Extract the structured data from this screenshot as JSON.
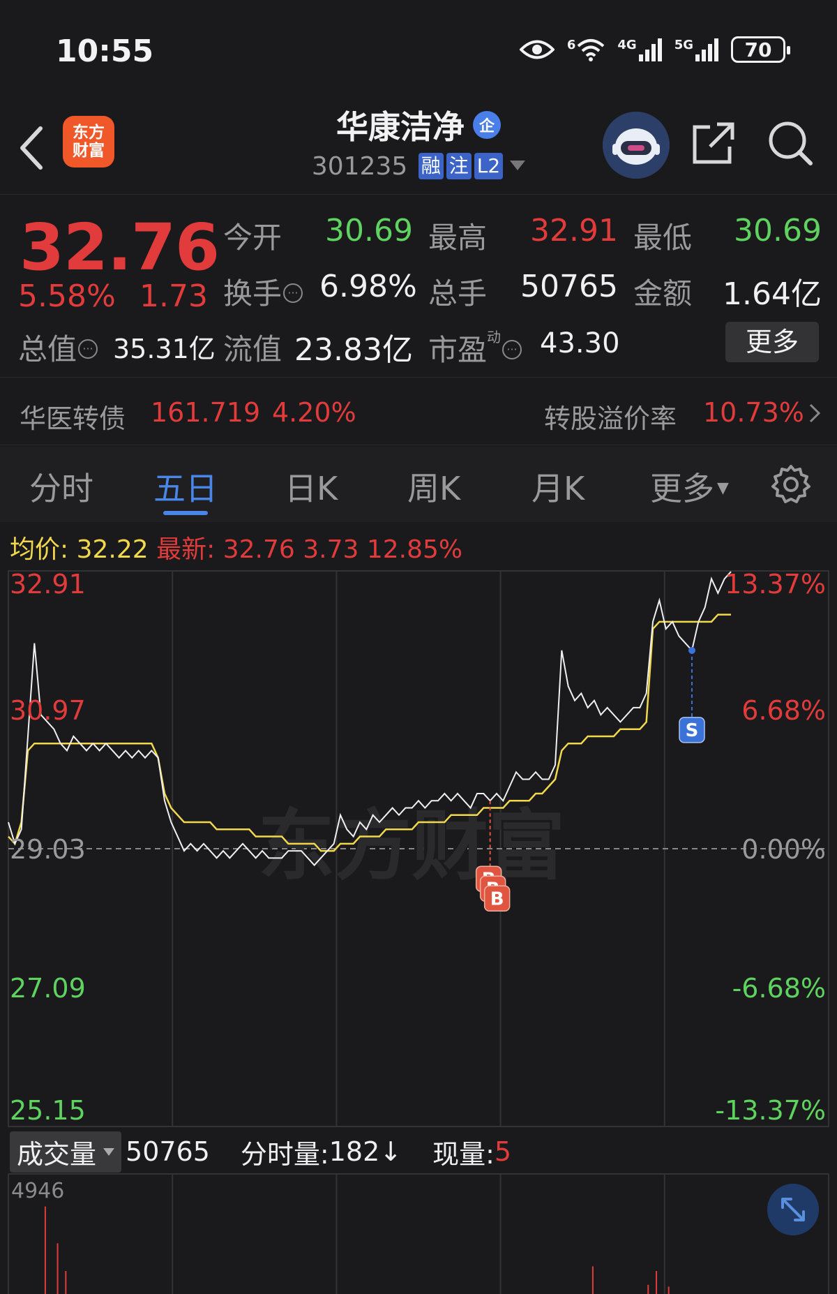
{
  "status_bar": {
    "time": "10:55",
    "wifi_label": "6",
    "net1": "4G",
    "net2": "5G",
    "battery": "70"
  },
  "header": {
    "app_logo_line1": "东方",
    "app_logo_line2": "财富",
    "title": "华康洁净",
    "title_badge": "企",
    "code": "301235",
    "tag_margin": "融",
    "tag_note": "注",
    "tag_level": "L2"
  },
  "quote": {
    "price": "32.76",
    "change_pct": "5.58%",
    "change_amt": "1.73",
    "open_label": "今开",
    "open_value": "30.69",
    "high_label": "最高",
    "high_value": "32.91",
    "low_label": "最低",
    "low_value": "30.69",
    "turnover_label": "换手",
    "turnover_value": "6.98%",
    "volume_label": "总手",
    "volume_value": "50765",
    "amount_label": "金额",
    "amount_value": "1.64亿",
    "mktcap_label": "总值",
    "mktcap_value": "35.31亿",
    "float_label": "流值",
    "float_value": "23.83亿",
    "pe_label": "市盈",
    "pe_sup": "动",
    "pe_value": "43.30",
    "more_label": "更多"
  },
  "bond": {
    "name": "华医转债",
    "price": "161.719",
    "pct": "4.20%",
    "premium_label": "转股溢价率",
    "premium_value": "10.73%"
  },
  "tabs": [
    "分时",
    "五日",
    "日K",
    "周K",
    "月K",
    "更多"
  ],
  "active_tab": "五日",
  "chart_info": {
    "avg_label": "均价:",
    "avg_value": "32.22",
    "latest_label": "最新:",
    "latest_value": "32.76",
    "latest_change": "3.73",
    "latest_pct": "12.85%"
  },
  "watermark": "东方财富",
  "colors": {
    "up": "#e23b3b",
    "down": "#5fd35f",
    "price_line": "#f0f0f0",
    "avg_line": "#f2d84b",
    "accent": "#4a86e8",
    "buy_marker": "#e05540",
    "sell_marker": "#3b72d8"
  },
  "chart_data": {
    "type": "line",
    "title": "",
    "days": 5,
    "y_ticks_left": [
      "32.91",
      "30.97",
      "29.03",
      "27.09",
      "25.15"
    ],
    "y_ticks_right": [
      "13.37%",
      "6.68%",
      "0.00%",
      "-6.68%",
      "-13.37%"
    ],
    "ylim": [
      25.15,
      32.91
    ],
    "prev_close": 29.03,
    "series": [
      {
        "values": [
          29.4,
          29.1,
          29.3,
          30.6,
          31.9,
          30.9,
          30.8,
          30.7,
          30.5,
          30.4,
          30.6,
          30.5,
          30.4,
          30.5,
          30.4,
          30.5,
          30.4,
          30.3,
          30.4,
          30.3,
          30.4,
          30.3,
          30.4,
          30.3,
          29.7,
          29.4,
          29.2,
          29.0,
          29.1,
          29.0,
          29.1,
          29.0,
          28.9,
          29.0,
          28.9,
          29.0,
          29.1,
          29.0,
          28.9,
          29.0,
          28.9,
          28.9,
          28.9,
          29.0,
          29.0,
          29.0,
          28.9,
          28.8,
          28.9,
          29.0,
          29.1,
          29.5,
          29.3,
          29.2,
          29.4,
          29.3,
          29.5,
          29.4,
          29.5,
          29.6,
          29.5,
          29.6,
          29.6,
          29.7,
          29.6,
          29.7,
          29.7,
          29.8,
          29.7,
          29.8,
          29.7,
          29.6,
          29.8,
          29.8,
          29.7,
          29.8,
          29.7,
          29.9,
          30.1,
          30.0,
          30.0,
          30.1,
          30.0,
          30.0,
          30.2,
          31.8,
          31.3,
          31.1,
          31.2,
          31.0,
          31.1,
          30.9,
          31.0,
          30.9,
          30.8,
          30.9,
          31.0,
          31.0,
          31.2,
          32.2,
          32.5,
          32.1,
          32.2,
          32.0,
          31.9,
          31.8,
          32.2,
          32.4,
          32.8,
          32.6,
          32.8,
          32.9
        ],
        "day_breaks": [
          23,
          48,
          73,
          98
        ]
      },
      {
        "values": [
          29.2,
          29.1,
          29.4,
          30.4,
          30.5,
          30.5,
          30.5,
          30.5,
          30.5,
          30.5,
          30.5,
          30.5,
          30.5,
          30.5,
          30.5,
          30.5,
          30.5,
          30.5,
          30.5,
          30.5,
          30.5,
          30.5,
          30.5,
          30.3,
          29.8,
          29.6,
          29.5,
          29.4,
          29.4,
          29.4,
          29.4,
          29.4,
          29.3,
          29.3,
          29.3,
          29.3,
          29.3,
          29.3,
          29.2,
          29.2,
          29.2,
          29.2,
          29.2,
          29.1,
          29.1,
          29.1,
          29.1,
          29.1,
          29.0,
          29.0,
          29.0,
          29.1,
          29.1,
          29.1,
          29.2,
          29.2,
          29.2,
          29.2,
          29.3,
          29.3,
          29.3,
          29.3,
          29.3,
          29.4,
          29.4,
          29.4,
          29.4,
          29.4,
          29.5,
          29.5,
          29.5,
          29.5,
          29.5,
          29.6,
          29.6,
          29.6,
          29.6,
          29.7,
          29.7,
          29.7,
          29.7,
          29.8,
          29.8,
          29.9,
          30.0,
          30.4,
          30.5,
          30.5,
          30.5,
          30.6,
          30.6,
          30.6,
          30.6,
          30.6,
          30.7,
          30.7,
          30.7,
          30.7,
          30.8,
          32.1,
          32.2,
          32.2,
          32.2,
          32.2,
          32.2,
          32.2,
          32.2,
          32.2,
          32.2,
          32.3,
          32.3,
          32.3
        ]
      }
    ],
    "markers": [
      {
        "label": "B",
        "type": "buy",
        "count": 3
      },
      {
        "label": "S",
        "type": "sell",
        "count": 1
      }
    ]
  },
  "volume": {
    "selector_label": "成交量",
    "total": "50765",
    "minute_label": "分时量:",
    "minute_value": "182",
    "minute_arrow": "↓",
    "current_label": "现量:",
    "current_value": "5",
    "axis_max": "4946"
  }
}
